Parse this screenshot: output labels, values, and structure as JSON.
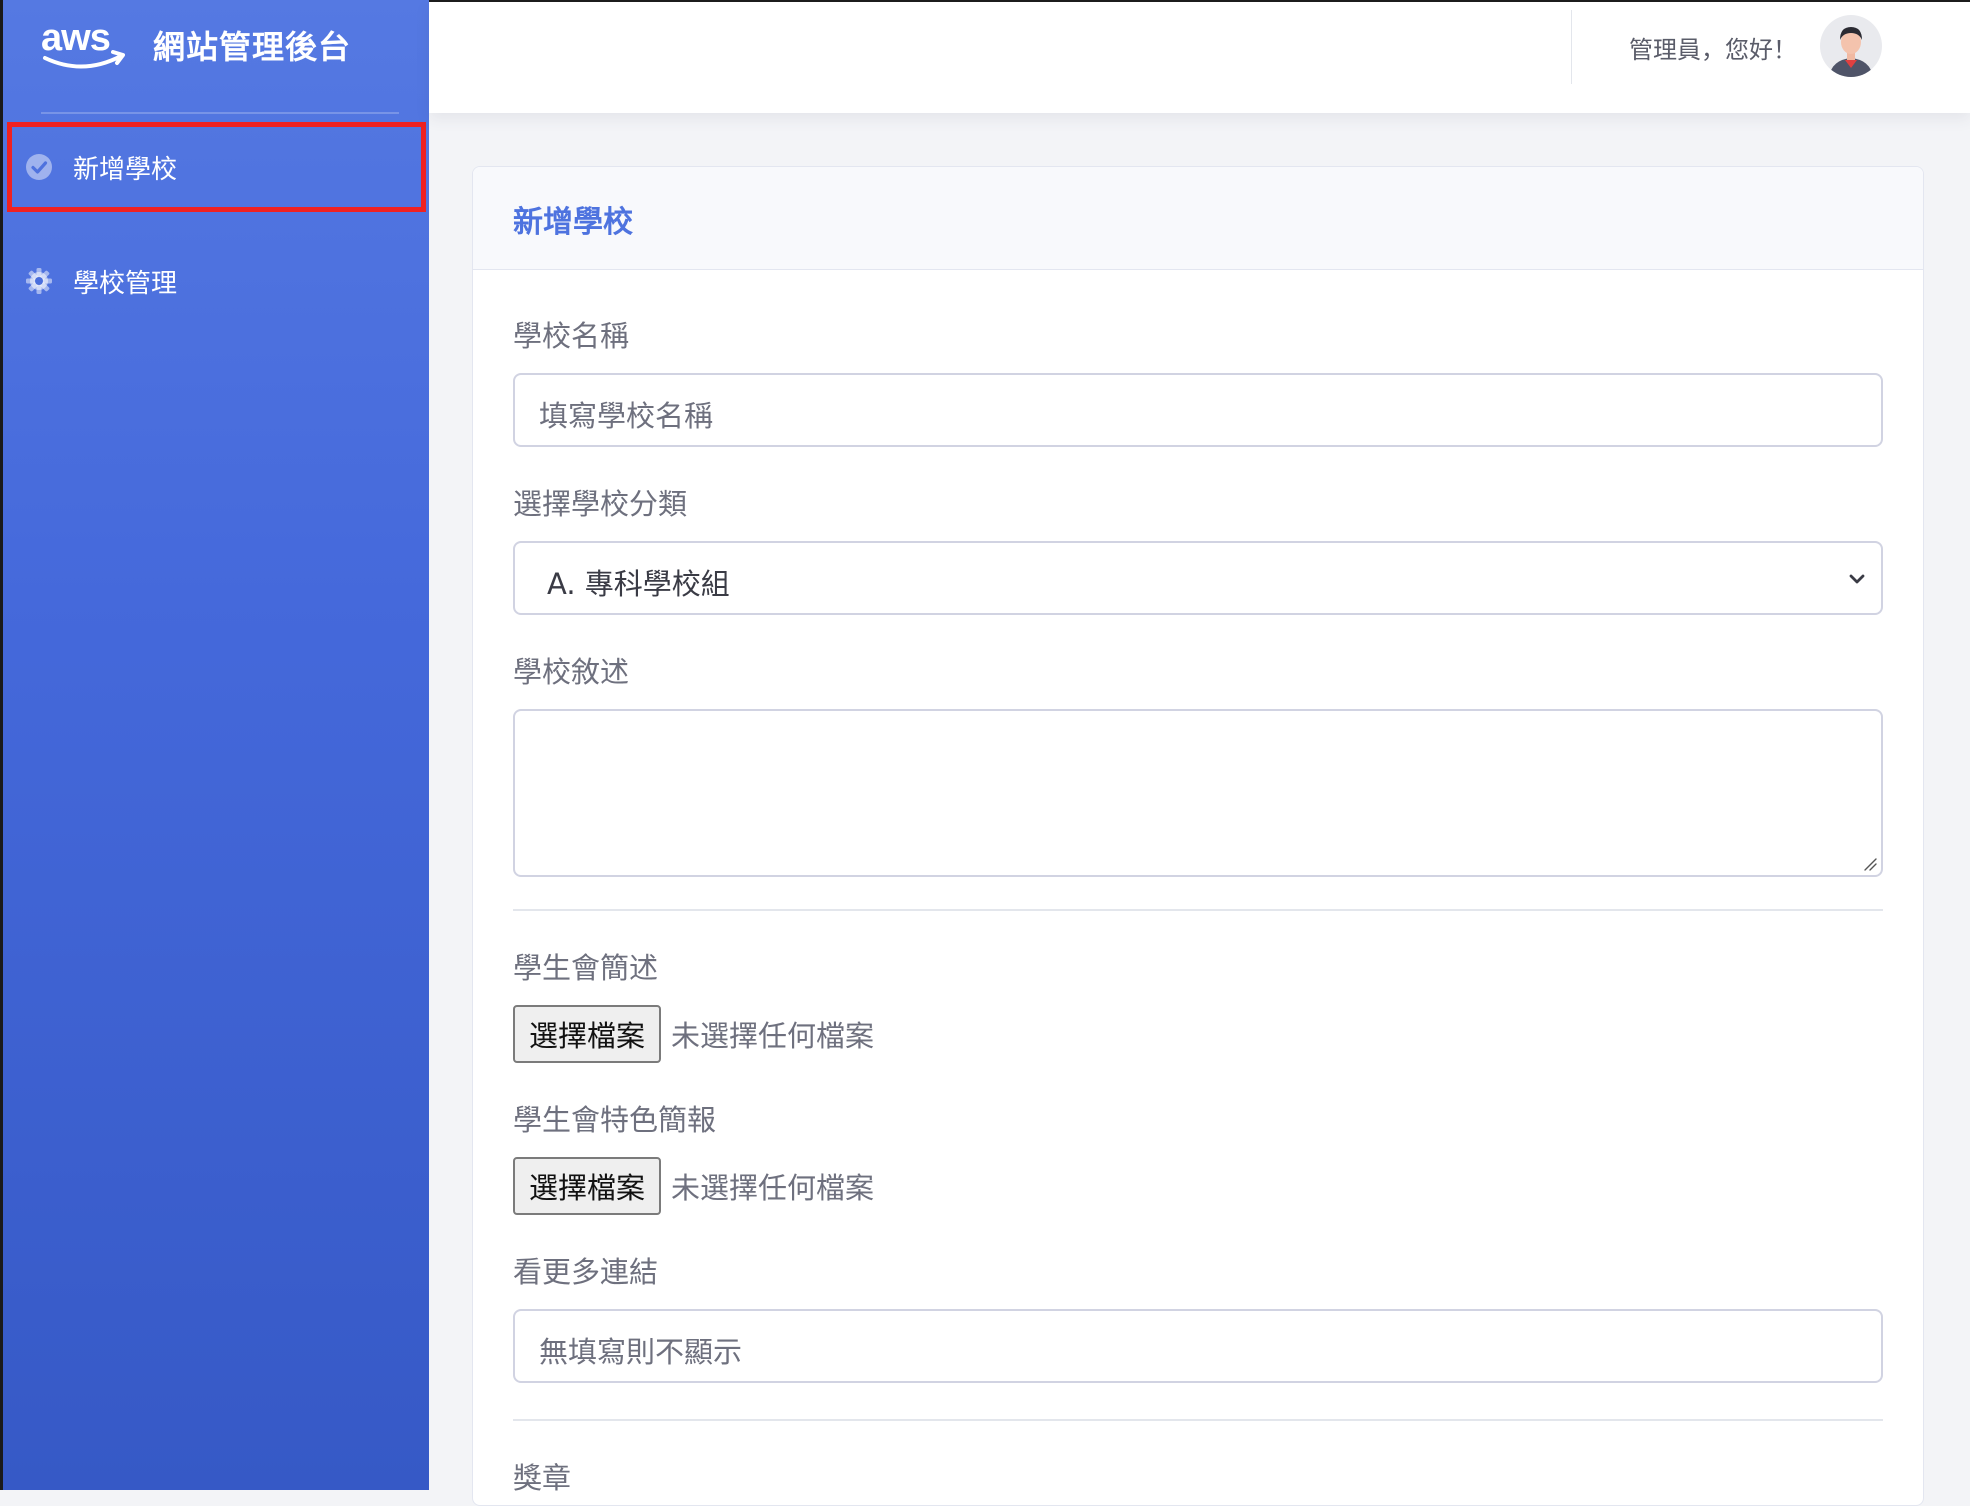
{
  "app": {
    "title": "網站管理後台"
  },
  "sidebar": {
    "items": [
      {
        "label": "新增學校",
        "icon": "check-circle-icon",
        "active": true
      },
      {
        "label": "學校管理",
        "icon": "gear-icon",
        "active": false
      }
    ]
  },
  "topbar": {
    "greeting": "管理員，您好！",
    "avatar": "avatar"
  },
  "form": {
    "header": "新增學校",
    "school_name": {
      "label": "學校名稱",
      "placeholder": "填寫學校名稱"
    },
    "school_category": {
      "label": "選擇學校分類",
      "selected": "A. 專科學校組"
    },
    "school_description": {
      "label": "學校敘述",
      "value": ""
    },
    "student_council_intro": {
      "label": "學生會簡述",
      "button": "選擇檔案",
      "status": "未選擇任何檔案"
    },
    "student_council_briefing": {
      "label": "學生會特色簡報",
      "button": "選擇檔案",
      "status": "未選擇任何檔案"
    },
    "more_link": {
      "label": "看更多連結",
      "placeholder": "無填寫則不顯示"
    },
    "awards": {
      "label": "獎章"
    }
  },
  "colors": {
    "primary": "#4e73df",
    "highlight": "#ef2121"
  }
}
